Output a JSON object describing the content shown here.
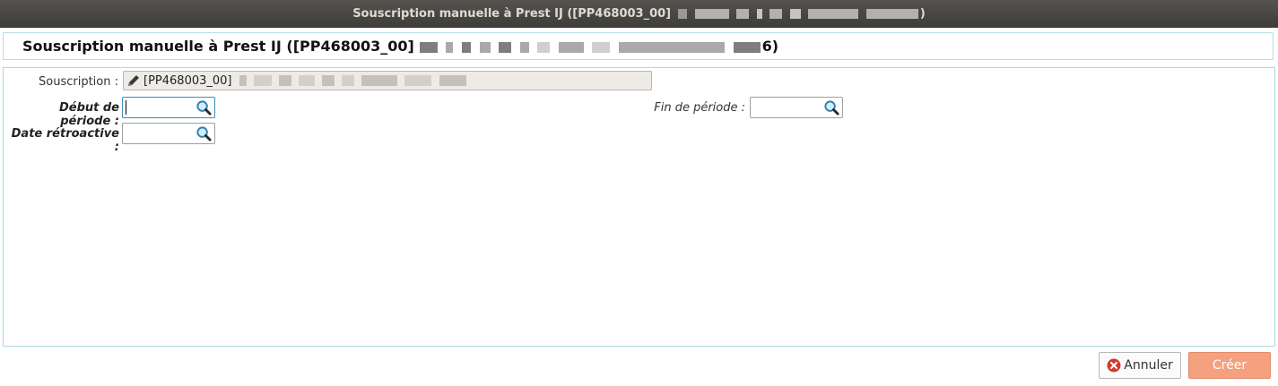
{
  "window": {
    "title": "Souscription manuelle à Prest IJ ([PP468003_00]",
    "title_end": ")"
  },
  "header": {
    "title": "Souscription manuelle à Prest IJ ([PP468003_00]",
    "title_end": "6)"
  },
  "form": {
    "souscription_label": "Souscription :",
    "souscription_value": "[PP468003_00]",
    "debut_label": "Début de période :",
    "debut_value": "",
    "fin_label": "Fin de période :",
    "fin_value": "",
    "date_retro_label": "Date rétroactive :",
    "date_retro_value": ""
  },
  "buttons": {
    "annuler": "Annuler",
    "creer": "Créer"
  },
  "colors": {
    "create_button": "#f5a07e",
    "panel_border": "#a9d8e0",
    "titlebar": "#3d3c38"
  },
  "icons": {
    "edit": "pencil-icon",
    "search": "magnifier-icon",
    "cancel": "close-circle-icon"
  }
}
